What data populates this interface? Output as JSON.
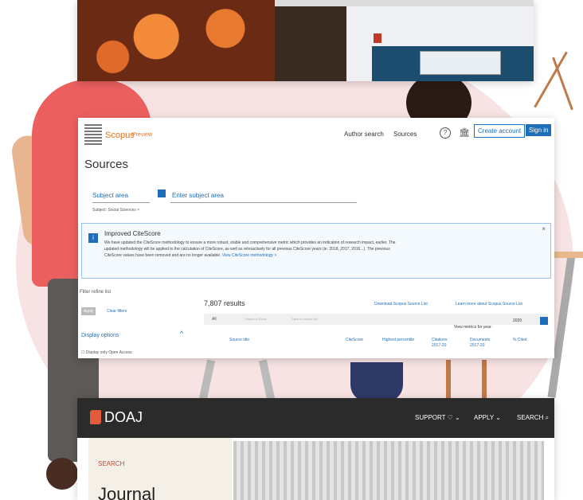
{
  "colors": {
    "scopus_accent": "#e9711c",
    "scopus_blue": "#1e6fb8",
    "doaj_bar": "#2b2b2b",
    "doaj_accent": "#e25b3a"
  },
  "scopus": {
    "brand": "Scopus",
    "preview": "Preview",
    "nav": {
      "author_search": "Author search",
      "sources": "Sources"
    },
    "icons": {
      "help": "?",
      "institution": "🏛"
    },
    "buttons": {
      "create_account": "Create account",
      "sign_in": "Sign in"
    },
    "title": "Sources",
    "subject_area": {
      "label": "Subject area",
      "placeholder": "Enter subject area",
      "tag": "Subject: Social Sciences ×"
    },
    "notice": {
      "title": "Improved CiteScore",
      "text": "We have updated the CiteScore methodology to ensure a more robust, stable and comprehensive metric which provides an indication of research impact, earlier. The updated methodology will be applied to the calculation of CiteScore, as well as retroactively for all previous CiteScore years (ie. 2018, 2017, 2016...). The previous CiteScore values have been removed and are no longer available.",
      "link": "View CiteScore methodology >",
      "close": "×"
    },
    "filter": {
      "label": "Filter refine list",
      "limit": "Apply",
      "clear": "Clear filters"
    },
    "display": {
      "label": "Display options",
      "chevron": "^",
      "open_access": "Display only Open Access"
    },
    "results": "7,807 results",
    "download": "Download Scopus Source List",
    "learn_more": "Learn more about Scopus Source List",
    "toolbar": {
      "all": "All",
      "export": "Export to Excel",
      "save": "Save to source list"
    },
    "view_metrics": "View metrics for year:",
    "year": "2020",
    "columns": [
      "Source title",
      "CiteScore",
      "Highest percentile",
      "Citations 2017-20",
      "Documents 2017-20",
      "% Cited"
    ]
  },
  "doaj": {
    "logo": "DOAJ",
    "nav": {
      "support": "SUPPORT ♡ ⌄",
      "apply": "APPLY ⌄",
      "search": "SEARCH ⌕"
    },
    "search_label": "SEARCH",
    "heading": "Journal"
  }
}
